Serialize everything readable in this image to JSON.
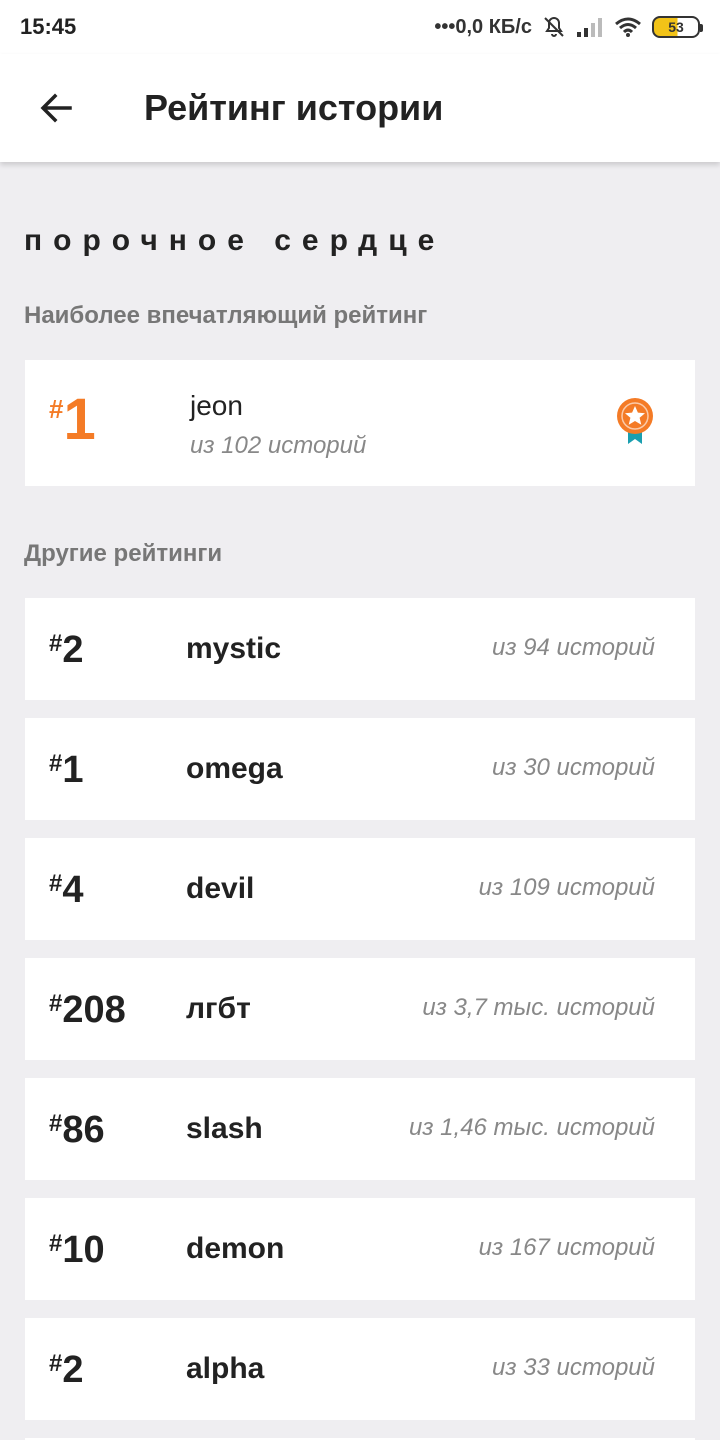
{
  "status_bar": {
    "time": "15:45",
    "network": "•••0,0 КБ/с",
    "battery": "53",
    "icons": [
      "mute-bell-icon",
      "signal-icon",
      "wifi-icon",
      "battery-icon"
    ]
  },
  "app_bar": {
    "title": "Рейтинг истории",
    "back_icon": "arrow-left-icon"
  },
  "story": {
    "title": "порочное сердце"
  },
  "top_section": {
    "label": "Наиболее впечатляющий рейтинг",
    "rank_hash": "#",
    "rank": "1",
    "tag": "jeon",
    "count": "из 102 историй",
    "icon": "medal-icon",
    "accent": "#f47b26"
  },
  "other_section": {
    "label": "Другие рейтинги",
    "items": [
      {
        "hash": "#",
        "rank": "2",
        "tag": "mystic",
        "count": "из 94 историй"
      },
      {
        "hash": "#",
        "rank": "1",
        "tag": "omega",
        "count": "из 30 историй"
      },
      {
        "hash": "#",
        "rank": "4",
        "tag": "devil",
        "count": "из 109 историй"
      },
      {
        "hash": "#",
        "rank": "208",
        "tag": "лгбт",
        "count": "из 3,7 тыс. историй"
      },
      {
        "hash": "#",
        "rank": "86",
        "tag": "slash",
        "count": "из 1,46 тыс. историй"
      },
      {
        "hash": "#",
        "rank": "10",
        "tag": "demon",
        "count": "из 167 историй"
      },
      {
        "hash": "#",
        "rank": "2",
        "tag": "alpha",
        "count": "из 33 историй"
      }
    ]
  }
}
